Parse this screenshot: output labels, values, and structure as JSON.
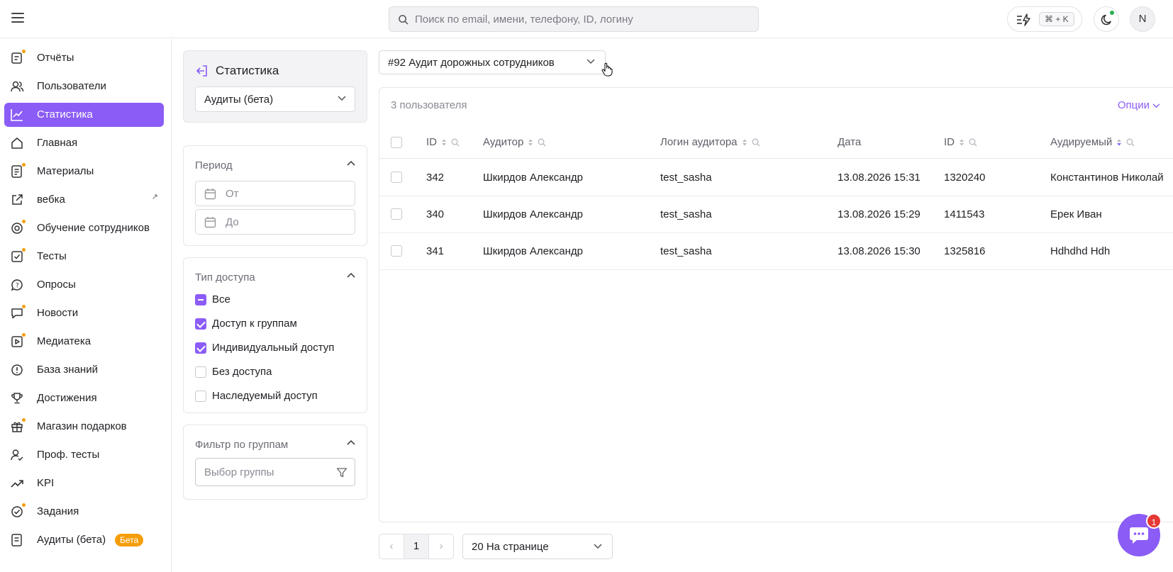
{
  "topbar": {
    "search_placeholder": "Поиск по email, имени, телефону, ID, логину",
    "shortcut": "⌘ + K",
    "avatar_initial": "N"
  },
  "sidebar": {
    "items": [
      {
        "label": "Отчёты",
        "icon": "report-icon"
      },
      {
        "label": "Пользователи",
        "icon": "users-icon"
      },
      {
        "label": "Статистика",
        "icon": "chart-line-icon",
        "active": true
      },
      {
        "label": "Главная",
        "icon": "home-icon"
      },
      {
        "label": "Материалы",
        "icon": "materials-icon"
      },
      {
        "label": "вебка",
        "icon": "external-link-icon",
        "external": true
      },
      {
        "label": "Обучение сотрудников",
        "icon": "training-icon"
      },
      {
        "label": "Тесты",
        "icon": "tests-icon"
      },
      {
        "label": "Опросы",
        "icon": "survey-icon"
      },
      {
        "label": "Новости",
        "icon": "news-icon"
      },
      {
        "label": "Медиатека",
        "icon": "media-icon"
      },
      {
        "label": "База знаний",
        "icon": "knowledge-icon"
      },
      {
        "label": "Достижения",
        "icon": "trophy-icon"
      },
      {
        "label": "Магазин подарков",
        "icon": "gift-icon"
      },
      {
        "label": "Проф. тесты",
        "icon": "prof-test-icon"
      },
      {
        "label": "KPI",
        "icon": "trend-icon"
      },
      {
        "label": "Задания",
        "icon": "tasks-icon"
      },
      {
        "label": "Аудиты (бета)",
        "icon": "audit-icon",
        "badge": "Бета"
      }
    ]
  },
  "filters": {
    "title": "Статистика",
    "report_type": "Аудиты (бета)",
    "period": {
      "title": "Период",
      "from": "От",
      "to": "До"
    },
    "access": {
      "title": "Тип доступа",
      "options": [
        {
          "label": "Все",
          "state": "partial"
        },
        {
          "label": "Доступ к группам",
          "state": "checked"
        },
        {
          "label": "Индивидуальный доступ",
          "state": "checked"
        },
        {
          "label": "Без доступа",
          "state": "unchecked"
        },
        {
          "label": "Наследуемый доступ",
          "state": "unchecked"
        }
      ]
    },
    "groups": {
      "title": "Фильтр по группам",
      "placeholder": "Выбор группы"
    }
  },
  "main": {
    "audit_select": "#92 Аудит дорожных сотрудников",
    "count": "3 пользователя",
    "options": "Опции",
    "columns": [
      "ID",
      "Аудитор",
      "Логин аудитора",
      "Дата",
      "ID",
      "Аудируемый"
    ],
    "rows": [
      [
        "342",
        "Шкирдов Александр",
        "test_sasha",
        "13.08.2026 15:31",
        "1320240",
        "Константинов Николай"
      ],
      [
        "340",
        "Шкирдов Александр",
        "test_sasha",
        "13.08.2026 15:29",
        "1411543",
        "Ерек Иван"
      ],
      [
        "341",
        "Шкирдов Александр",
        "test_sasha",
        "13.08.2026 15:30",
        "1325816",
        "Hdhdhd Hdh"
      ]
    ]
  },
  "pagination": {
    "prev": "‹",
    "page": "1",
    "next": "›",
    "per_page": "20 На странице"
  },
  "chat": {
    "badge": "1"
  },
  "colors": {
    "accent": "#8b5cf6",
    "badge_orange": "#f59e0b",
    "online": "#24b14f",
    "notification": "#e53935"
  }
}
